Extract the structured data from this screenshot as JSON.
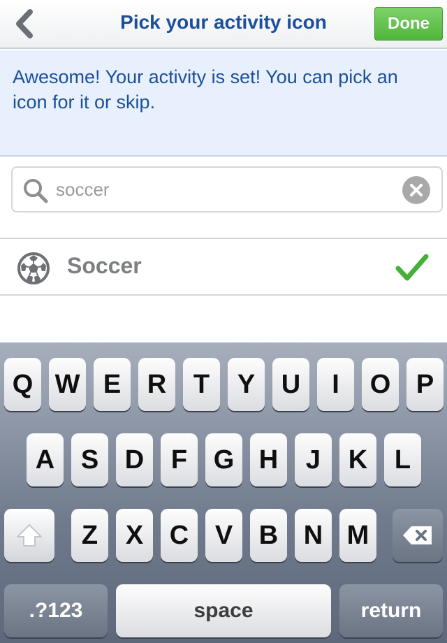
{
  "navbar": {
    "back_icon": "chevron-left-icon",
    "title": "Pick your activity icon",
    "done_label": "Done",
    "done_color": "#5cbf45"
  },
  "info": {
    "message": "Awesome! Your activity is set! You can pick an icon for it or skip."
  },
  "search": {
    "value": "soccer",
    "icon": "search-icon",
    "clear_icon": "clear-icon"
  },
  "results": [
    {
      "label": "Soccer",
      "icon": "soccer-ball-icon",
      "selected": true,
      "check_icon": "checkmark-icon",
      "check_color": "#45b139"
    }
  ],
  "keyboard": {
    "row1": [
      "Q",
      "W",
      "E",
      "R",
      "T",
      "Y",
      "U",
      "I",
      "O",
      "P"
    ],
    "row2": [
      "A",
      "S",
      "D",
      "F",
      "G",
      "H",
      "J",
      "K",
      "L"
    ],
    "row3": [
      "Z",
      "X",
      "C",
      "V",
      "B",
      "N",
      "M"
    ],
    "shift_icon": "shift-icon",
    "backspace_icon": "backspace-icon",
    "numbers_label": ".?123",
    "space_label": "space",
    "return_label": "return"
  }
}
